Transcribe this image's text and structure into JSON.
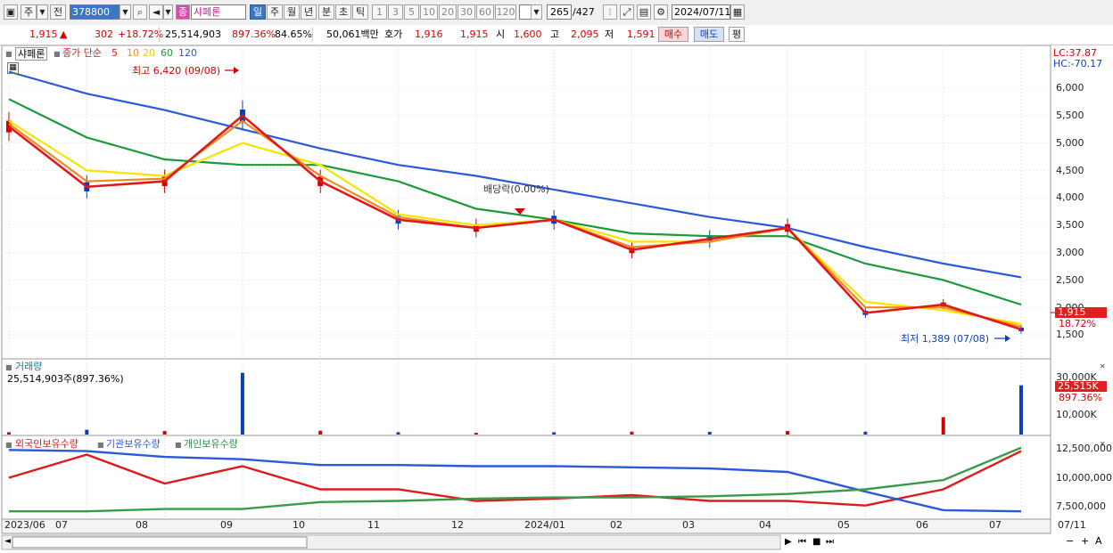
{
  "toolbar": {
    "period_label": "주",
    "prev_label": "전",
    "code": "378800",
    "name_badge": "종",
    "name": "샤페론",
    "periods": [
      "일",
      "주",
      "월",
      "년",
      "분",
      "초",
      "틱"
    ],
    "active_period": "일",
    "intervals": [
      "1",
      "3",
      "5",
      "10",
      "20",
      "30",
      "60",
      "120"
    ],
    "count": "265",
    "total": "/427",
    "date": "2024/07/11"
  },
  "quote": {
    "price": "1,915",
    "change": "302",
    "change_pct": "+18.72%",
    "volume": "25,514,903",
    "volume_pct": "897.36%",
    "ratio": "84.65%",
    "amount": "50,061백만",
    "hoga_label": "호가",
    "hoga1": "1,916",
    "hoga2": "1,915",
    "open_label": "시",
    "open": "1,600",
    "high_label": "고",
    "high": "2,095",
    "low_label": "저",
    "low": "1,591",
    "buy_label": "매수",
    "sell_label": "매도",
    "avg_label": "평"
  },
  "price_panel": {
    "name": "샤페론",
    "ma_legend_prefix": "종가 단순",
    "ma_periods": [
      "5",
      "10",
      "20",
      "60",
      "120"
    ],
    "ma_colors": [
      "#e01a1a",
      "#f08a1e",
      "#f5e400",
      "#1a9a3a",
      "#2a5ad8"
    ],
    "high_note": "최고 6,420 (09/08)",
    "low_note": "최저 1,389 (07/08)",
    "dividend_note": "배당락(0.00%)",
    "lc": "LC:37.87",
    "hc": "HC:-70.17",
    "price_tag": "1,915",
    "pct_tag": "18.72%",
    "y_ticks": [
      "6,000",
      "5,500",
      "5,000",
      "4,500",
      "4,000",
      "3,500",
      "3,000",
      "2,500",
      "2,000",
      "1,500"
    ]
  },
  "volume_panel": {
    "title": "거래량",
    "value": "25,514,903주(897.36%)",
    "y_ticks": [
      "30,000K",
      "10,000K"
    ],
    "tag": "25,515K",
    "tag_pct": "897.36%"
  },
  "holding_panel": {
    "legend": [
      "외국인보유수량",
      "기관보유수량",
      "개인보유수량"
    ],
    "colors": [
      "#e01a1a",
      "#2a5ad8",
      "#3a9a4a"
    ],
    "y_ticks": [
      "12,500,000",
      "10,000,000",
      "7,500,000"
    ]
  },
  "x_axis": [
    "2023/06",
    "07",
    "08",
    "09",
    "10",
    "11",
    "12",
    "2024/01",
    "02",
    "03",
    "04",
    "05",
    "06",
    "07",
    "07/11"
  ],
  "chart_data": [
    {
      "type": "line",
      "title": "샤페론",
      "ylabel": "",
      "ylim": [
        1389,
        6420
      ],
      "categories": [
        "2023/06",
        "07",
        "08",
        "09",
        "10",
        "11",
        "12",
        "2024/01",
        "02",
        "03",
        "04",
        "05",
        "06",
        "07"
      ],
      "series": [
        {
          "name": "종가 단순 5",
          "values": [
            5300,
            4200,
            4300,
            5500,
            4300,
            3600,
            3450,
            3600,
            3050,
            3250,
            3450,
            1900,
            2050,
            1600
          ]
        },
        {
          "name": "10",
          "values": [
            5350,
            4300,
            4350,
            5400,
            4400,
            3650,
            3450,
            3600,
            3100,
            3200,
            3450,
            2000,
            2000,
            1650
          ]
        },
        {
          "name": "20",
          "values": [
            5400,
            4500,
            4400,
            5000,
            4600,
            3700,
            3500,
            3600,
            3200,
            3200,
            3450,
            2100,
            1950,
            1700
          ]
        },
        {
          "name": "60",
          "values": [
            5800,
            5100,
            4700,
            4600,
            4600,
            4300,
            3800,
            3600,
            3350,
            3300,
            3300,
            2800,
            2500,
            2050
          ]
        },
        {
          "name": "120",
          "values": [
            6300,
            5900,
            5600,
            5250,
            4900,
            4600,
            4400,
            4150,
            3900,
            3650,
            3450,
            3100,
            2800,
            2550
          ]
        }
      ],
      "annotations": [
        "최고 6,420 (09/08)",
        "최저 1,389 (07/08)",
        "배당락(0.00%)"
      ]
    },
    {
      "type": "bar",
      "title": "거래량",
      "categories": [
        "2023/06",
        "07",
        "08",
        "09",
        "10",
        "11",
        "12",
        "2024/01",
        "02",
        "03",
        "04",
        "05",
        "06",
        "07"
      ],
      "values": [
        1200,
        2500,
        1800,
        32000,
        2000,
        1200,
        900,
        1200,
        1500,
        1400,
        1800,
        1500,
        9000,
        25515
      ],
      "ylabel": "K"
    },
    {
      "type": "line",
      "title": "보유수량",
      "categories": [
        "2023/06",
        "07",
        "08",
        "09",
        "10",
        "11",
        "12",
        "2024/01",
        "02",
        "03",
        "04",
        "05",
        "06",
        "07"
      ],
      "series": [
        {
          "name": "외국인보유수량",
          "values": [
            10000000,
            12000000,
            9500000,
            11000000,
            9000000,
            9000000,
            8000000,
            8200000,
            8500000,
            8000000,
            8000000,
            7600000,
            9000000,
            12300000
          ]
        },
        {
          "name": "기관보유수량",
          "values": [
            12400000,
            12300000,
            11800000,
            11600000,
            11100000,
            11100000,
            11000000,
            11000000,
            10900000,
            10800000,
            10500000,
            8800000,
            7200000,
            7100000
          ]
        },
        {
          "name": "개인보유수량",
          "values": [
            7100000,
            7100000,
            7300000,
            7300000,
            7900000,
            8000000,
            8200000,
            8300000,
            8300000,
            8400000,
            8600000,
            9000000,
            9800000,
            12600000
          ]
        }
      ]
    }
  ]
}
